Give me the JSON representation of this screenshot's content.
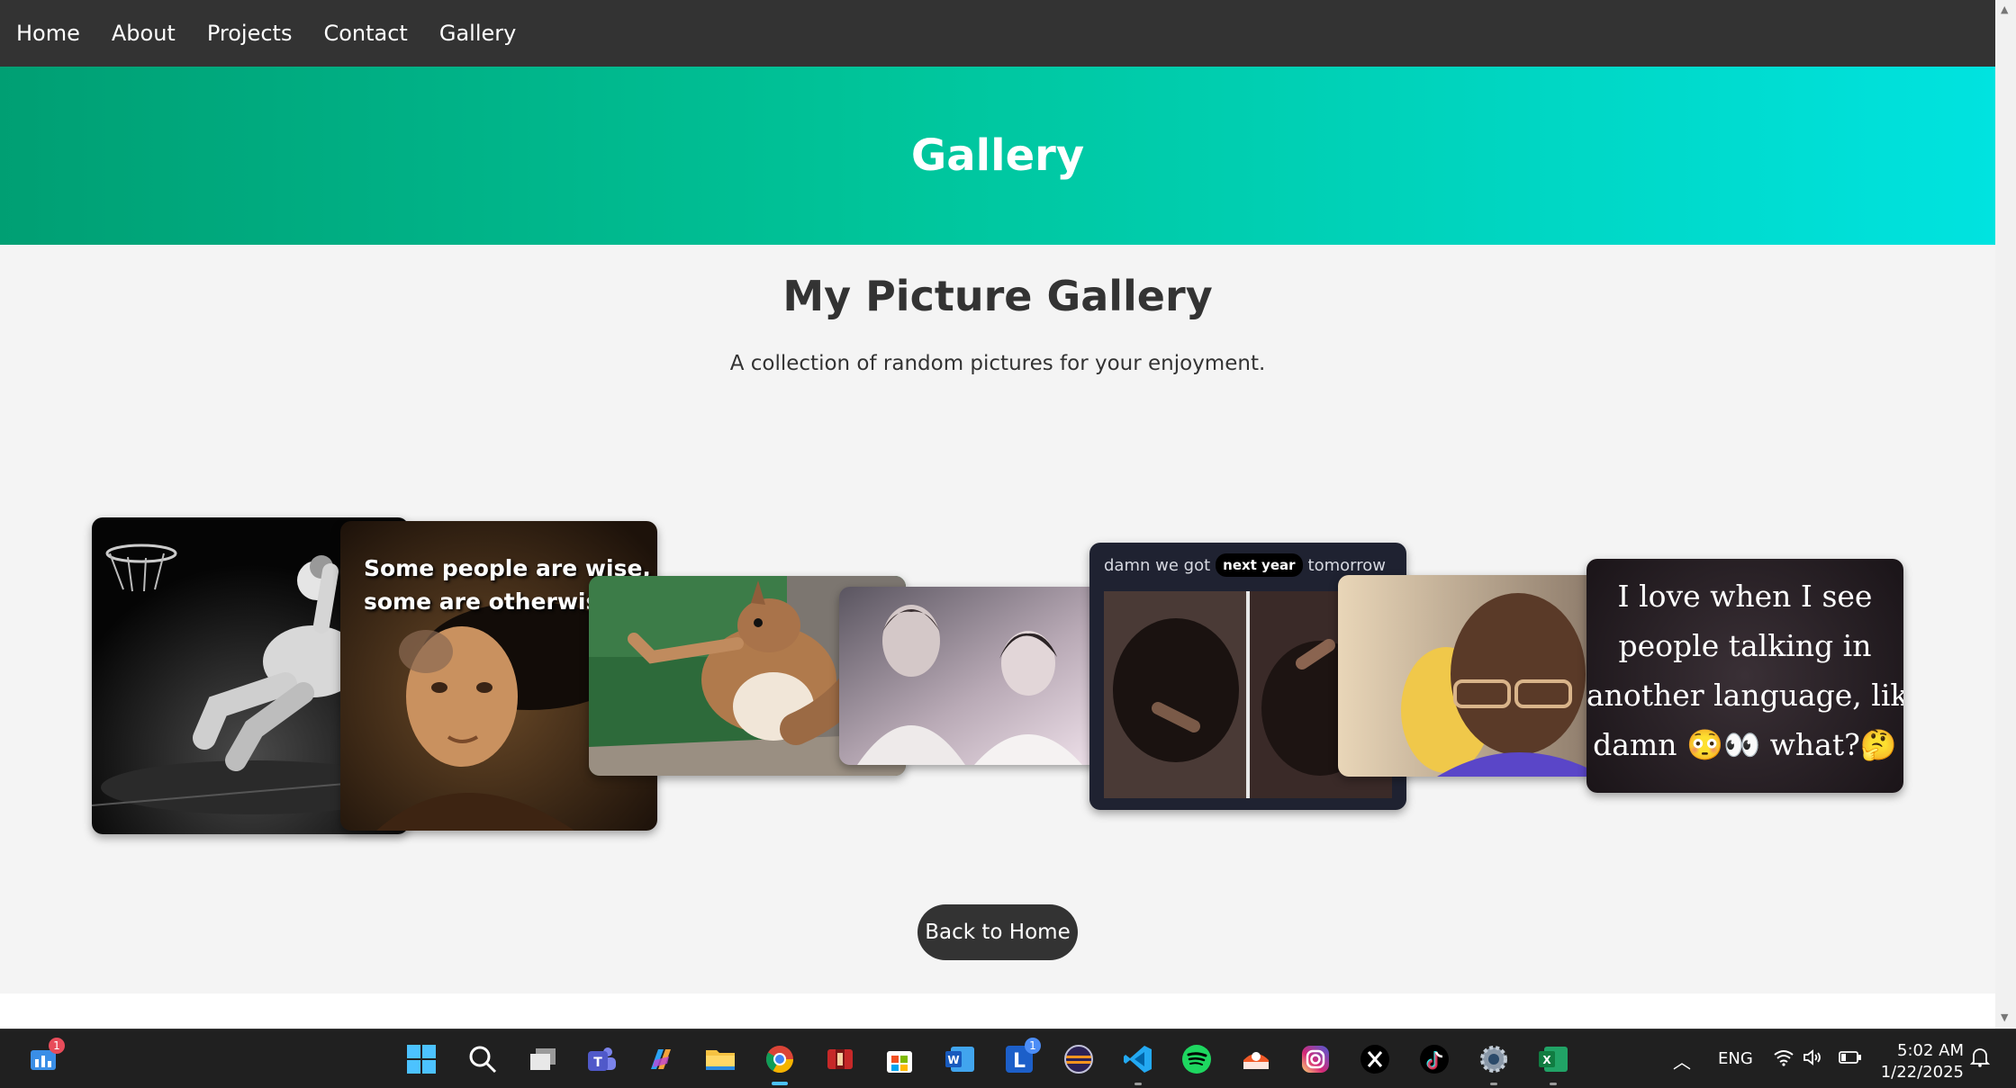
{
  "nav": {
    "items": [
      {
        "label": "Home"
      },
      {
        "label": "About"
      },
      {
        "label": "Projects"
      },
      {
        "label": "Contact"
      },
      {
        "label": "Gallery"
      }
    ]
  },
  "hero": {
    "title": "Gallery"
  },
  "gallery": {
    "heading": "My Picture Gallery",
    "subtitle": "A collection of random pictures for your enjoyment.",
    "cards": [
      {
        "name": "basketball-dunk-image"
      },
      {
        "name": "wise-portrait-meme",
        "caption_line1": "Some people are wise,",
        "caption_line2": "some are otherwise."
      },
      {
        "name": "squirrel-image"
      },
      {
        "name": "anime-boys-image"
      },
      {
        "name": "next-year-meme",
        "caption_before": "damn we got",
        "caption_pill": "next year",
        "caption_after": "tomorrow"
      },
      {
        "name": "man-with-glasses-image"
      },
      {
        "name": "language-meme",
        "lines": [
          "I love when I see",
          "people talking in",
          "another language, like",
          "damn 😳👀 what?🤔"
        ]
      }
    ]
  },
  "back_button": {
    "label": "Back to Home"
  },
  "taskbar": {
    "icons": [
      "widgets-icon",
      "start-icon",
      "search-icon",
      "task-view-icon",
      "teams-icon",
      "copilot-icon",
      "file-explorer-icon",
      "chrome-icon",
      "app-red-icon",
      "store-icon",
      "word-icon",
      "lens-l-icon",
      "eclipse-icon",
      "vscode-icon",
      "spotify-icon",
      "app-orange-icon",
      "instagram-icon",
      "x-icon",
      "tiktok-icon",
      "settings-icon",
      "excel-icon"
    ],
    "widgets_badge": "1",
    "lens_badge": "1",
    "language": "ENG",
    "time": "5:02 AM",
    "date": "1/22/2025"
  },
  "colors": {
    "navbar": "#333333",
    "hero_gradient_start": "#009f73",
    "hero_gradient_end": "#00e3e0",
    "button": "#333333"
  }
}
